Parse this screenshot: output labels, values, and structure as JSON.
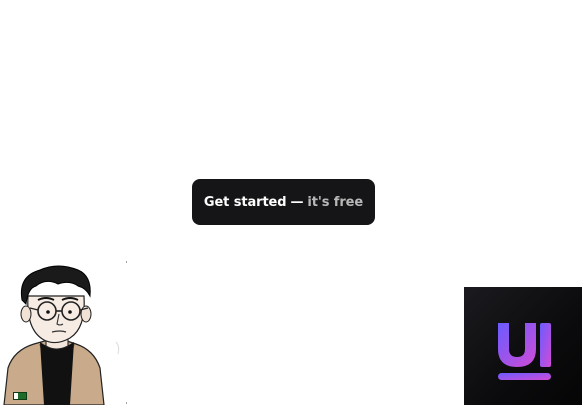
{
  "cta": {
    "label": "Get started",
    "separator": "—",
    "accent": "it's free"
  },
  "avatar": {
    "icon": "cartoon-man-avatar-icon",
    "badge_icon": "flag-badge-icon"
  },
  "logo": {
    "icon": "ui-logo-icon",
    "text": "UI",
    "colors": {
      "tile": "#0d0d0f",
      "gradient_start": "#6a5cff",
      "gradient_end": "#d14bd6"
    }
  }
}
